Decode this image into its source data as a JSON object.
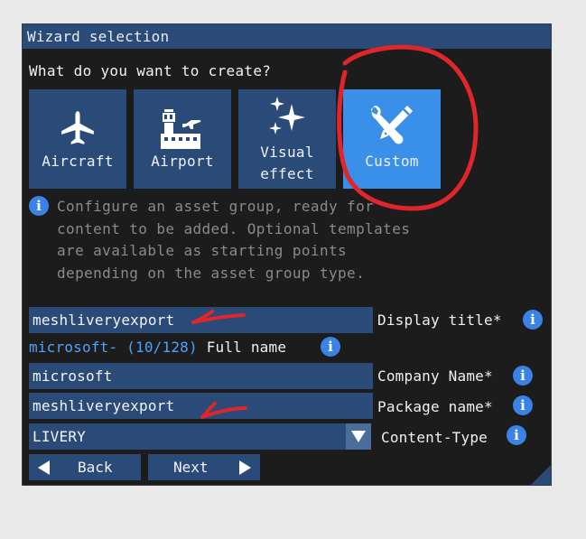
{
  "window": {
    "title": "Wizard selection",
    "question": "What do you want to create?"
  },
  "types": [
    {
      "label": "Aircraft",
      "icon": "airplane-icon",
      "selected": false
    },
    {
      "label": "Airport",
      "icon": "airport-tower-icon",
      "selected": false
    },
    {
      "label": "Visual effect",
      "icon": "sparkles-icon",
      "selected": false
    },
    {
      "label": "Custom",
      "icon": "tools-icon",
      "selected": true
    }
  ],
  "description": "Configure an asset group, ready for content to be added. Optional templates are available as starting points depending on the asset group type.",
  "form": {
    "display_title": {
      "value": "meshliveryexport",
      "label": "Display title*"
    },
    "full_name": {
      "prefix": "microsoft-",
      "count": "(10/128)",
      "label": "Full name"
    },
    "company_name": {
      "value": "microsoft",
      "label": "Company Name*"
    },
    "package_name": {
      "value": "meshliveryexport",
      "label": "Package name*"
    },
    "content_type": {
      "value": "LIVERY",
      "label": "Content-Type"
    }
  },
  "buttons": {
    "back": "Back",
    "next": "Next"
  },
  "colors": {
    "panel": "#2a4a78",
    "selected": "#3a8fe8",
    "info": "#3b82e6",
    "annotation": "#e0262b"
  }
}
